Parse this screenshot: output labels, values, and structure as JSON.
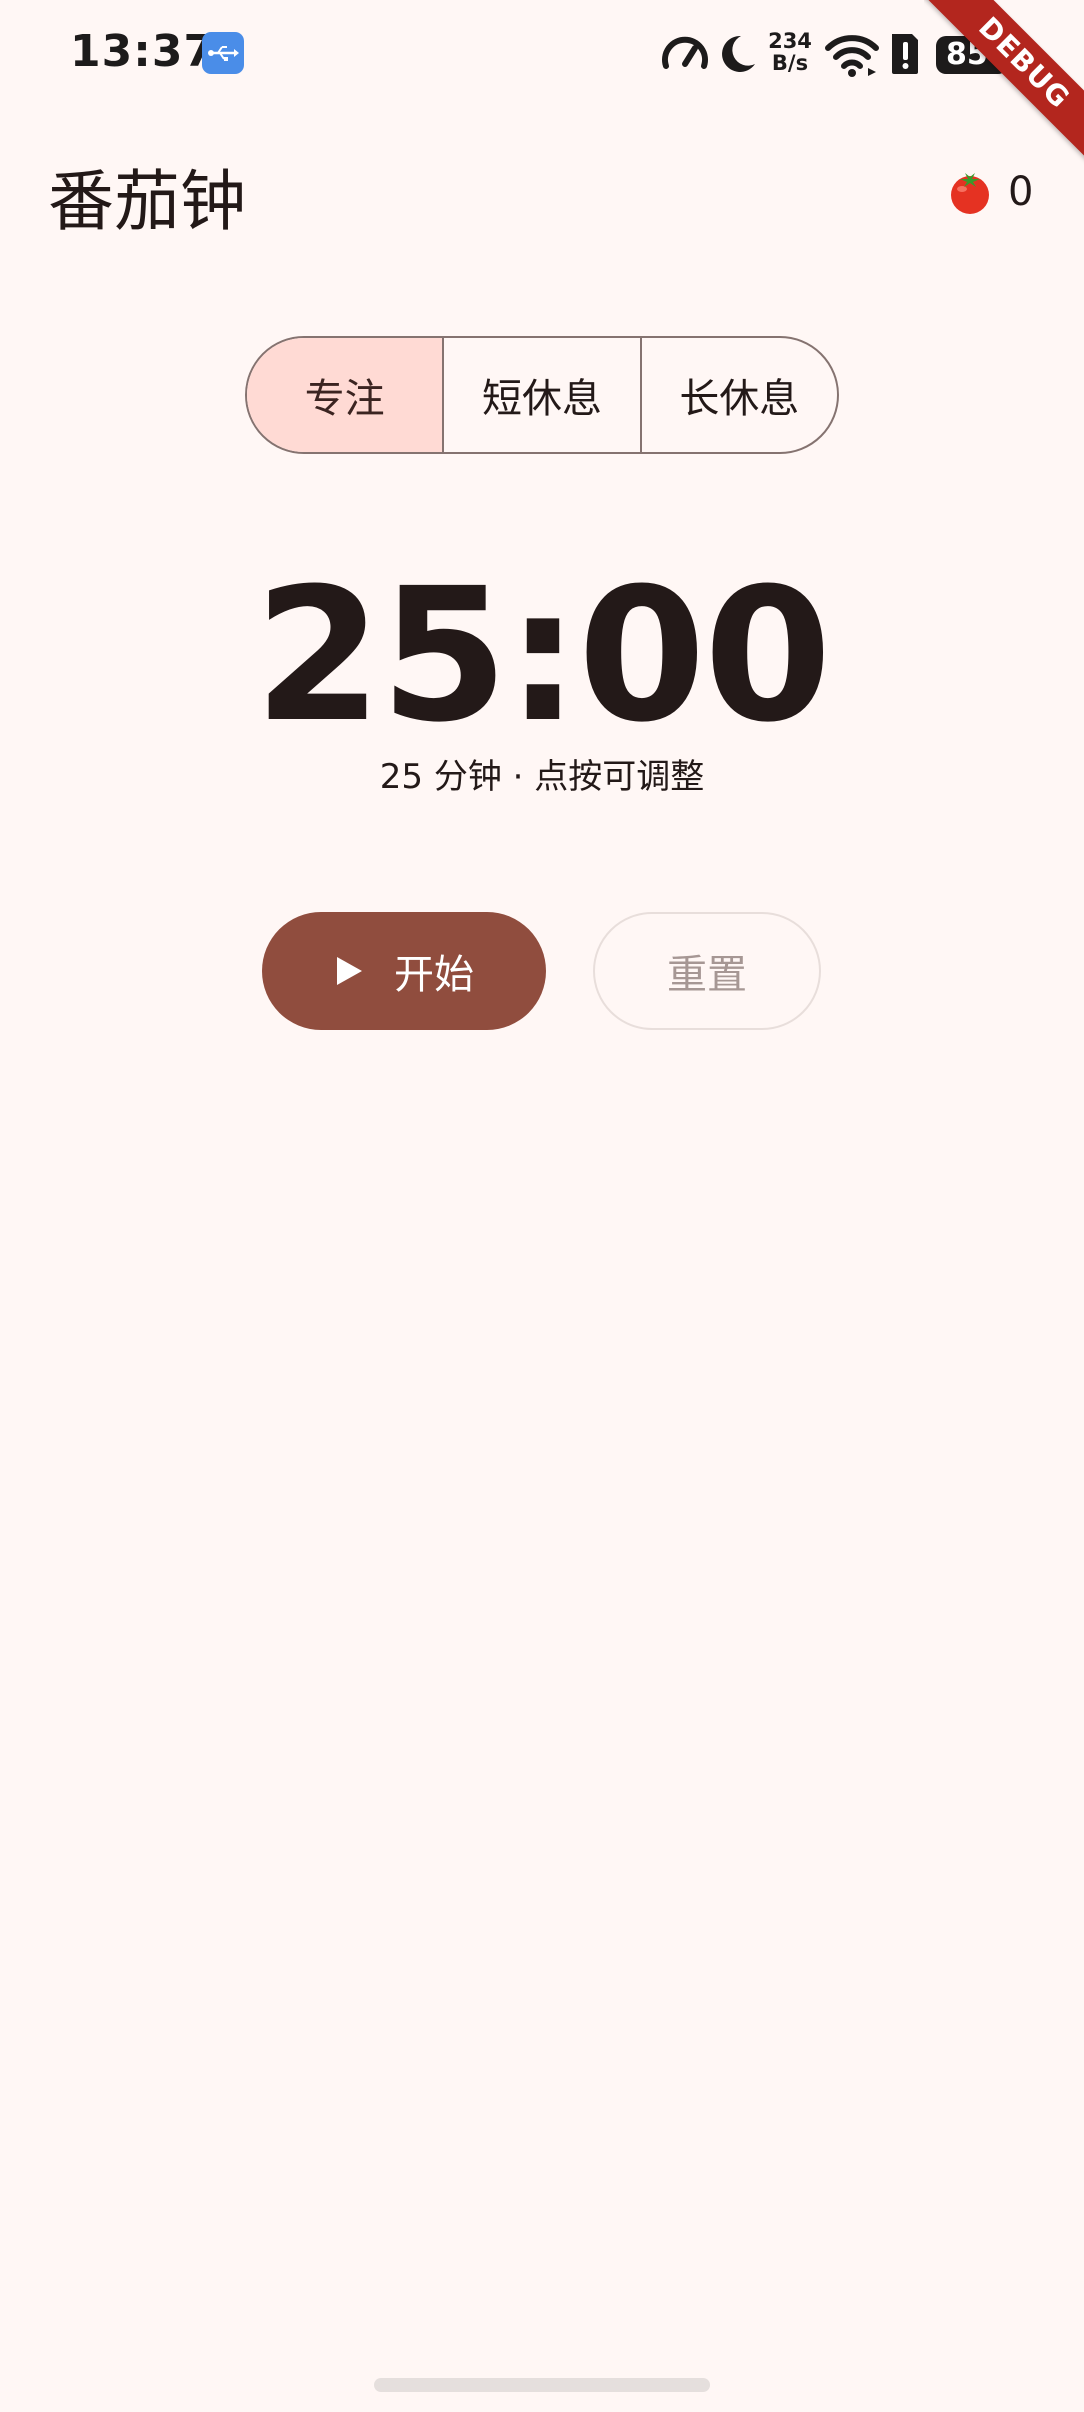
{
  "status_bar": {
    "time": "13:37",
    "net_rate_value": "234",
    "net_rate_unit": "B/s",
    "battery": "85"
  },
  "debug_banner": "DEBUG",
  "app_bar": {
    "title": "番茄钟",
    "completed_count": "0"
  },
  "modes": [
    {
      "label": "专注",
      "selected": true
    },
    {
      "label": "短休息",
      "selected": false
    },
    {
      "label": "长休息",
      "selected": false
    }
  ],
  "timer": {
    "display": "25:00",
    "hint": "25 分钟 · 点按可调整"
  },
  "actions": {
    "start_label": "开始",
    "reset_label": "重置"
  },
  "colors": {
    "background": "#fff7f5",
    "primary": "#904d3e",
    "selected_segment": "#ffdad4",
    "outline": "#857370",
    "disabled_text": "#a69794"
  }
}
